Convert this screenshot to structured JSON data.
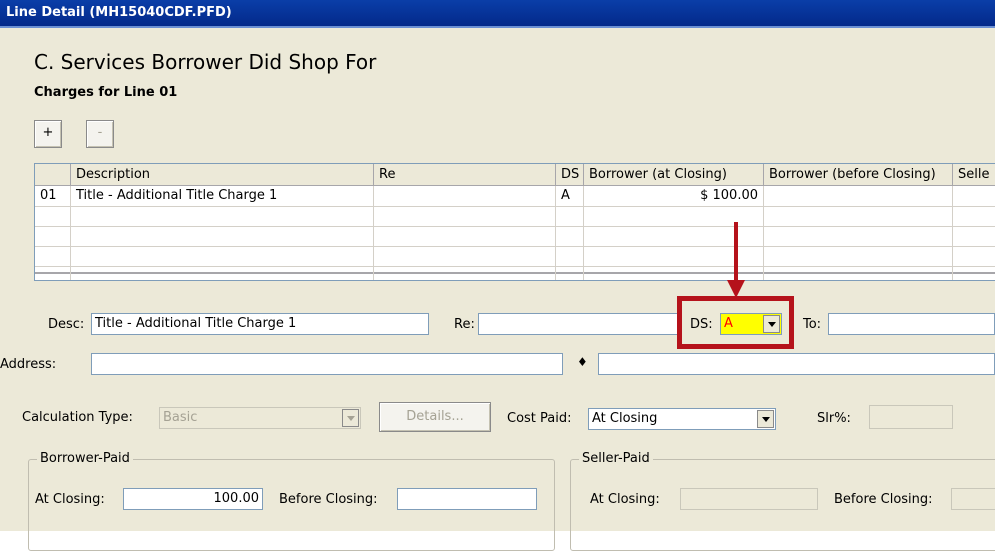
{
  "window": {
    "title": "Line Detail (MH15040CDF.PFD)"
  },
  "header": {
    "section_title": "C. Services Borrower Did Shop For",
    "subtitle": "Charges for Line 01"
  },
  "toolbar": {
    "add_label": "+",
    "remove_label": "-"
  },
  "grid": {
    "columns": [
      "",
      "Description",
      "Re",
      "DS",
      "Borrower (at Closing)",
      "Borrower (before Closing)",
      "Selle"
    ],
    "rows": [
      {
        "num": "01",
        "description": "Title - Additional Title Charge 1",
        "re": "",
        "ds": "A",
        "borrower_at_closing": "$ 100.00",
        "borrower_before_closing": "",
        "seller": ""
      }
    ]
  },
  "form": {
    "desc_label": "Desc:",
    "desc_value": "Title - Additional Title Charge 1",
    "re_label": "Re:",
    "re_value": "",
    "ds_label": "DS:",
    "ds_value": "A",
    "to_label": "To:",
    "to_value": "",
    "address_label": "Address:",
    "address_value": "",
    "bullet": "♦",
    "calc_type_label": "Calculation Type:",
    "calc_type_value": "Basic",
    "details_label": "Details...",
    "cost_paid_label": "Cost Paid:",
    "cost_paid_value": "At Closing",
    "slr_label": "Slr%:",
    "slr_value": ""
  },
  "borrower_paid": {
    "title": "Borrower-Paid",
    "at_closing_label": "At Closing:",
    "at_closing_value": "100.00",
    "before_closing_label": "Before Closing:",
    "before_closing_value": ""
  },
  "seller_paid": {
    "title": "Seller-Paid",
    "at_closing_label": "At Closing:",
    "at_closing_value": "",
    "before_closing_label": "Before Closing:",
    "before_closing_value": ""
  },
  "colors": {
    "highlight": "#b5121b",
    "ds_field_bg": "#ffff00",
    "ds_text": "#ff0000"
  }
}
